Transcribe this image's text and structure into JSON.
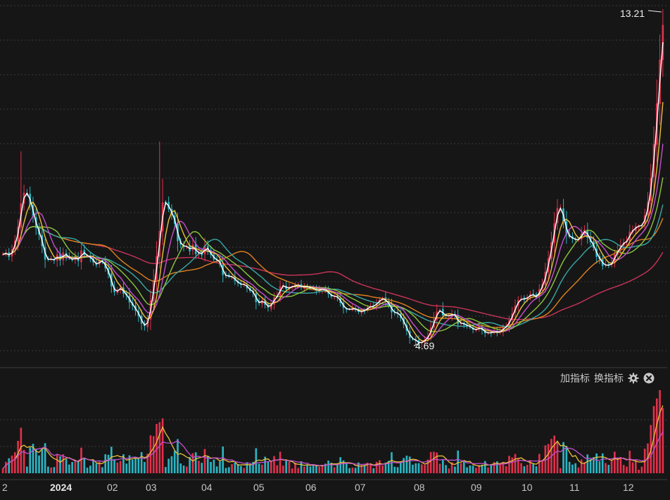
{
  "toolbar": {
    "add_indicator": "加指标",
    "switch_indicator": "换指标",
    "settings_icon": "gear-icon",
    "close_icon": "close-icon"
  },
  "chart_data": {
    "type": "candlestick",
    "annotations": {
      "high": "13.21",
      "low": "4.69"
    },
    "x_labels": [
      "2",
      "2024",
      "02",
      "03",
      "04",
      "05",
      "06",
      "07",
      "08",
      "09",
      "10",
      "11",
      "12"
    ],
    "price_range": [
      4.5,
      13.3
    ],
    "volume_panel": {
      "series_colors": [
        "#e8c23a",
        "#c64fd0"
      ]
    },
    "colors": {
      "up": "#e0314b",
      "down": "#2bb5c4",
      "ma_white": "#ffffff",
      "ma_yellow": "#e8c23a",
      "ma_magenta": "#c64fd0",
      "ma_green": "#8bc53f",
      "ma_cyan": "#3aa9a6",
      "ma_orange": "#e0801e",
      "ma_red": "#c9345a",
      "grid": "#3a3a3a",
      "background": "#161616"
    },
    "closes": [
      6.98,
      7.03,
      6.92,
      7.11,
      7.33,
      7.68,
      8.28,
      8.55,
      8.52,
      8.25,
      7.94,
      7.65,
      7.49,
      7.19,
      6.85,
      6.86,
      6.86,
      6.83,
      6.98,
      6.83,
      7.03,
      6.93,
      6.88,
      6.84,
      6.92,
      6.81,
      7.08,
      6.97,
      6.94,
      6.89,
      6.78,
      6.71,
      6.83,
      6.8,
      6.63,
      6.48,
      6.17,
      6.02,
      6.08,
      6.14,
      5.98,
      5.94,
      5.76,
      5.68,
      5.55,
      5.42,
      5.22,
      5.16,
      5.32,
      5.81,
      6.3,
      6.94,
      7.58,
      8.3,
      8.29,
      8.14,
      7.98,
      7.76,
      7.32,
      7.23,
      7.17,
      7.2,
      7.06,
      7.23,
      6.99,
      7.05,
      6.96,
      7.21,
      7.06,
      6.97,
      6.85,
      6.84,
      6.73,
      6.46,
      6.44,
      6.42,
      6.41,
      6.31,
      6.25,
      6.21,
      6.23,
      6.12,
      6.06,
      6.01,
      5.77,
      5.75,
      5.82,
      5.7,
      5.63,
      5.73,
      5.89,
      5.93,
      6.17,
      6.2,
      6.1,
      6.16,
      6.16,
      6.2,
      6.21,
      6.14,
      6.18,
      6.14,
      6.13,
      6.11,
      6.06,
      6.09,
      6.1,
      6.07,
      5.98,
      5.91,
      5.93,
      5.88,
      5.75,
      5.62,
      5.59,
      5.58,
      5.61,
      5.59,
      5.52,
      5.54,
      5.56,
      5.64,
      5.66,
      5.67,
      5.76,
      5.83,
      5.87,
      5.78,
      5.71,
      5.51,
      5.51,
      5.48,
      5.37,
      5.21,
      5.04,
      4.86,
      4.83,
      4.78,
      4.72,
      4.76,
      4.82,
      4.91,
      5.12,
      5.33,
      5.53,
      5.57,
      5.43,
      5.43,
      5.42,
      5.47,
      5.43,
      5.21,
      5.26,
      5.19,
      5.18,
      5.13,
      5.07,
      5.07,
      5.13,
      5.06,
      4.98,
      5,
      4.98,
      5.04,
      4.99,
      5.03,
      5.12,
      5.16,
      5.31,
      5.48,
      5.68,
      5.82,
      5.86,
      5.84,
      5.9,
      5.97,
      5.94,
      5.89,
      6.1,
      6.22,
      6.54,
      6.88,
      7.29,
      7.77,
      8.16,
      8.15,
      7.82,
      7.48,
      7.43,
      7.38,
      7.35,
      7.36,
      7.51,
      7.61,
      7.4,
      7.29,
      7.15,
      6.92,
      6.86,
      6.69,
      6.73,
      6.69,
      6.78,
      6.98,
      7.09,
      7.22,
      7.29,
      7.33,
      7.56,
      7.6,
      7.7,
      7.7,
      7.73,
      7.97,
      8.31,
      8.92,
      9.78,
      10.82,
      11.93,
      12.81
    ]
  }
}
